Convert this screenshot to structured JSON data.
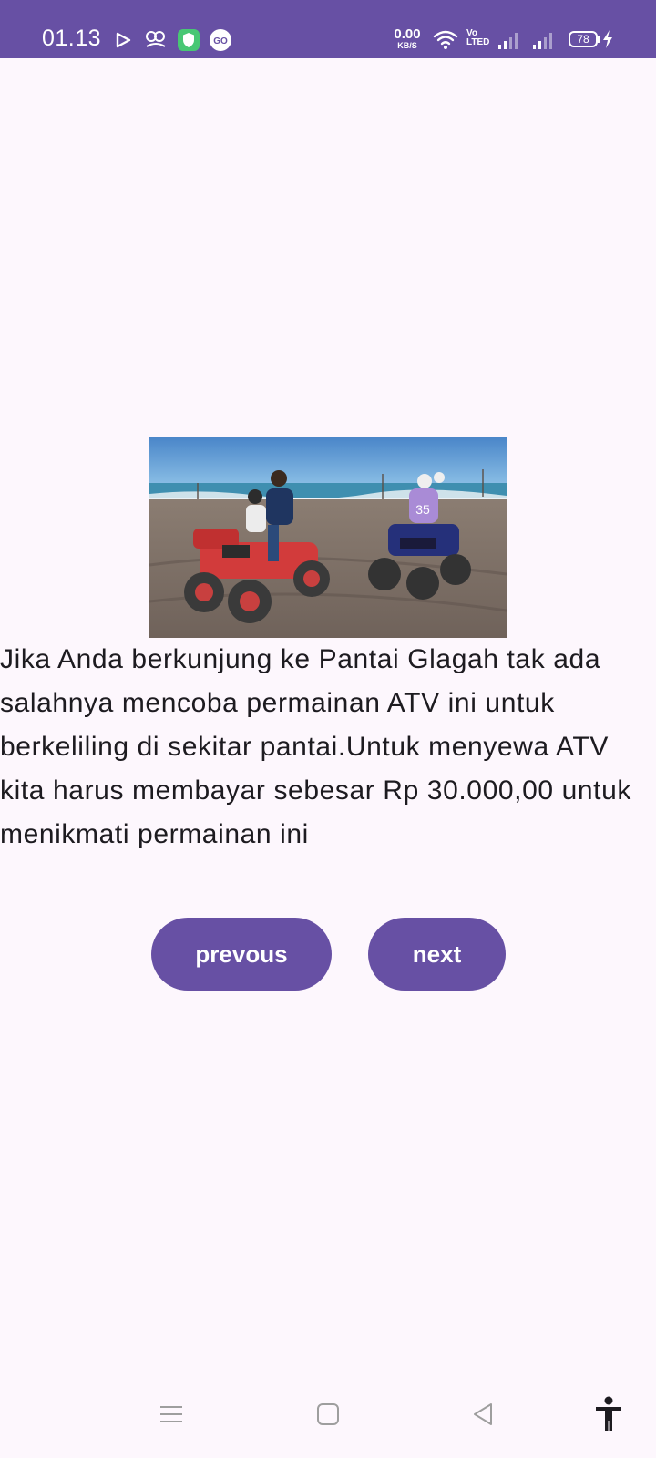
{
  "status_bar": {
    "time": "01.13",
    "net_speed_value": "0.00",
    "net_speed_unit": "KB/S",
    "volte_line1": "Vo",
    "volte_line2": "LTED",
    "battery_level": "78",
    "background_color": "#6750a4"
  },
  "content": {
    "image_alt": "ATV riders on the beach",
    "description": "Jika Anda berkunjung ke Pantai Glagah tak ada salahnya mencoba permainan ATV ini untuk berkeliling di sekitar pantai.Untuk menyewa ATV kita harus membayar sebesar Rp 30.000,00 untuk menikmati permainan ini"
  },
  "buttons": {
    "previous_label": "prevous",
    "next_label": "next",
    "color": "#6750a4"
  },
  "nav_bar": {
    "items": [
      "menu-icon",
      "home-icon",
      "back-icon",
      "accessibility-icon"
    ]
  }
}
